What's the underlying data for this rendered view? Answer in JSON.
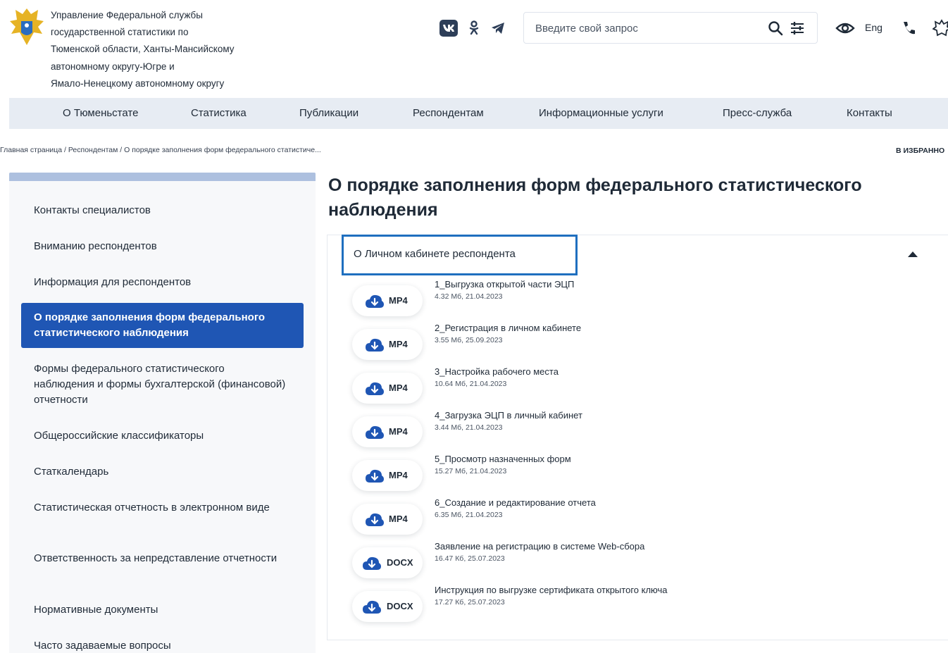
{
  "header": {
    "org_lines": [
      "Управление Федеральной службы",
      "государственной статистики по",
      "Тюменской области, Ханты-Мансийскому",
      "автономному округу-Югре и",
      "Ямало-Ненецкому автономному округу"
    ],
    "social": {
      "vk": "VK",
      "ok": "ok-icon",
      "telegram": "telegram-icon"
    },
    "search_placeholder": "Введите свой запрос",
    "lang": "Eng"
  },
  "nav": [
    "О Тюменьстате",
    "Статистика",
    "Публикации",
    "Респондентам",
    "Информационные услуги",
    "Пресс-служба",
    "Контакты"
  ],
  "breadcrumb": "Главная страница / Респондентам / О порядке заполнения форм федерального статистиче...",
  "favorites": "В ИЗБРАННО",
  "sidebar": {
    "items": [
      "Контакты специалистов",
      "Вниманию респондентов",
      "Информация для респондентов",
      "О порядке заполнения форм федерального статистического наблюдения",
      "Формы федерального статистического наблюдения и формы бухгалтерской (финансовой) отчетности",
      "Общероссийские классификаторы",
      "Статкалендарь",
      "Статистическая отчетность в электронном виде",
      "Ответственность за непредставление отчетности",
      "Нормативные документы",
      "Часто задаваемые вопросы"
    ],
    "active_index": 3
  },
  "main": {
    "title_line1": "О порядке заполнения форм федерального статистического",
    "title_line2": "наблюдения",
    "accordion_title": "О Личном кабинете респондента",
    "files": [
      {
        "ext": "MP4",
        "name": "1_Выгрузка открытой части ЭЦП",
        "meta": "4.32 Мб, 21.04.2023"
      },
      {
        "ext": "MP4",
        "name": "2_Регистрация в личном кабинете",
        "meta": "3.55 Мб, 25.09.2023"
      },
      {
        "ext": "MP4",
        "name": "3_Настройка рабочего места",
        "meta": "10.64 Мб, 21.04.2023"
      },
      {
        "ext": "MP4",
        "name": "4_Загрузка ЭЦП в личный кабинет",
        "meta": "3.44 Мб, 21.04.2023"
      },
      {
        "ext": "MP4",
        "name": "5_Просмотр назначенных форм",
        "meta": "15.27 Мб, 21.04.2023"
      },
      {
        "ext": "MP4",
        "name": "6_Создание и редактирование отчета",
        "meta": "6.35 Мб, 21.04.2023"
      },
      {
        "ext": "DOCX",
        "name": "Заявление на регистрацию в системе Web-сбора",
        "meta": "16.47 Кб, 25.07.2023"
      },
      {
        "ext": "DOCX",
        "name": "Инструкция по выгрузке сертификата открытого ключа",
        "meta": "17.27 Кб, 25.07.2023"
      }
    ]
  },
  "colors": {
    "primary": "#1f56b4",
    "nav_bg": "#e7ecf3",
    "sidebar_bg": "#f7f8fa",
    "highlight_border": "#1f6fbf",
    "text": "#1f2a37"
  }
}
